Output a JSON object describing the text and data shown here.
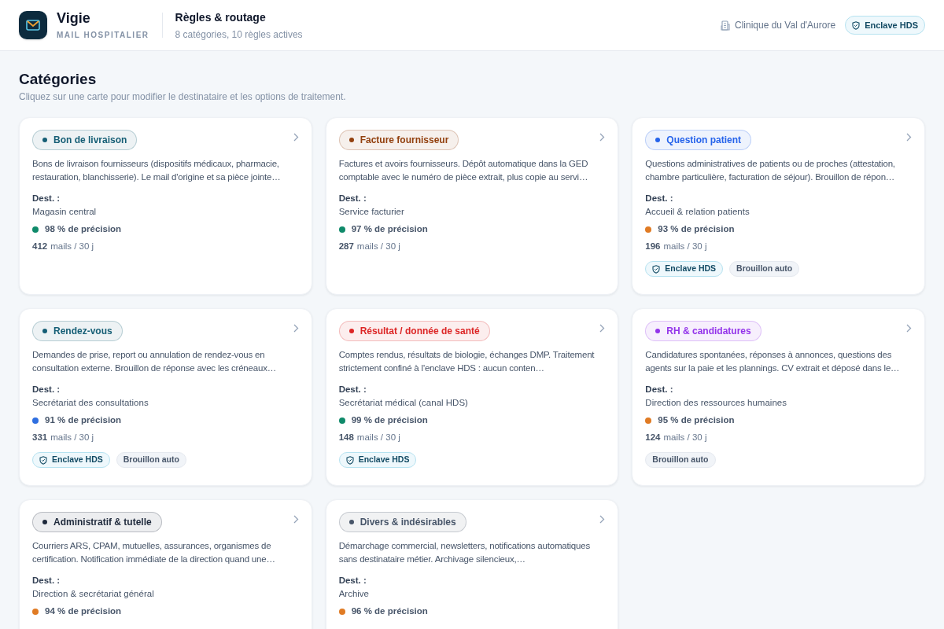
{
  "app": {
    "name": "Vigie",
    "subtitle": "MAIL HOSPITALIER"
  },
  "page": {
    "title": "Règles & routage",
    "summary": "8 catégories, 10 règles actives"
  },
  "organization": "Clinique du Val d'Aurore",
  "header_badge": "Enclave HDS",
  "section": {
    "title": "Catégories",
    "hint": "Cliquez sur une carte pour modifier le destinataire et les options de traitement."
  },
  "categories": [
    {
      "label": "Bon de livraison",
      "color": "#155e75",
      "description": "Bons de livraison fournisseurs (dispositifs médicaux, pharmacie, restauration, blanchisserie). Le mail d'origine et sa pièce jointe…",
      "dest_label": "Dest. :",
      "dest": "Magasin central",
      "precision": {
        "text": "98 % de précision",
        "color": "#0f8a6a"
      },
      "mails_count": "412",
      "mails_unit": "mails / 30 j"
    },
    {
      "label": "Facture fournisseur",
      "color": "#92400e",
      "description": "Factures et avoirs fournisseurs. Dépôt automatique dans la GED comptable avec le numéro de pièce extrait, plus copie au servi…",
      "dest_label": "Dest. :",
      "dest": "Service facturier",
      "precision": {
        "text": "97 % de précision",
        "color": "#0f8a6a"
      },
      "mails_count": "287",
      "mails_unit": "mails / 30 j"
    },
    {
      "label": "Question patient",
      "color": "#2563eb",
      "description": "Questions administratives de patients ou de proches (attestation, chambre particulière, facturation de séjour). Brouillon de répon…",
      "dest_label": "Dest. :",
      "dest": "Accueil & relation patients",
      "precision": {
        "text": "93 % de précision",
        "color": "#e07b24"
      },
      "mails_count": "196",
      "mails_unit": "mails / 30 j",
      "tags": [
        {
          "kind": "enclave",
          "label": "Enclave HDS"
        },
        {
          "kind": "draft",
          "label": "Brouillon auto"
        }
      ]
    },
    {
      "label": "Rendez-vous",
      "color": "#155e75",
      "description": "Demandes de prise, report ou annulation de rendez-vous en consultation externe. Brouillon de réponse avec les créneaux…",
      "dest_label": "Dest. :",
      "dest": "Secrétariat des consultations",
      "precision": {
        "text": "91 % de précision",
        "color": "#2f6fe0"
      },
      "mails_count": "331",
      "mails_unit": "mails / 30 j",
      "tags": [
        {
          "kind": "enclave",
          "label": "Enclave HDS"
        },
        {
          "kind": "draft",
          "label": "Brouillon auto"
        }
      ]
    },
    {
      "label": "Résultat / donnée de santé",
      "color": "#dc2626",
      "description": "Comptes rendus, résultats de biologie, échanges DMP. Traitement strictement confiné à l'enclave HDS : aucun conten…",
      "dest_label": "Dest. :",
      "dest": "Secrétariat médical (canal HDS)",
      "precision": {
        "text": "99 % de précision",
        "color": "#0f8a6a"
      },
      "mails_count": "148",
      "mails_unit": "mails / 30 j",
      "tags": [
        {
          "kind": "enclave",
          "label": "Enclave HDS"
        }
      ]
    },
    {
      "label": "RH & candidatures",
      "color": "#9333ea",
      "description": "Candidatures spontanées, réponses à annonces, questions des agents sur la paie et les plannings. CV extrait et déposé dans le…",
      "dest_label": "Dest. :",
      "dest": "Direction des ressources humaines",
      "precision": {
        "text": "95 % de précision",
        "color": "#e07b24"
      },
      "mails_count": "124",
      "mails_unit": "mails / 30 j",
      "tags": [
        {
          "kind": "draft",
          "label": "Brouillon auto"
        }
      ]
    },
    {
      "label": "Administratif & tutelle",
      "color": "#1e293b",
      "description": "Courriers ARS, CPAM, mutuelles, assurances, organismes de certification. Notification immédiate de la direction quand une…",
      "dest_label": "Dest. :",
      "dest": "Direction & secrétariat général",
      "precision": {
        "text": "94 % de précision",
        "color": "#e07b24"
      }
    },
    {
      "label": "Divers & indésirables",
      "color": "#475569",
      "description": "Démarchage commercial, newsletters, notifications automatiques sans destinataire métier. Archivage silencieux,…",
      "dest_label": "Dest. :",
      "dest": "Archive",
      "precision": {
        "text": "96 % de précision",
        "color": "#e07b24"
      }
    }
  ]
}
